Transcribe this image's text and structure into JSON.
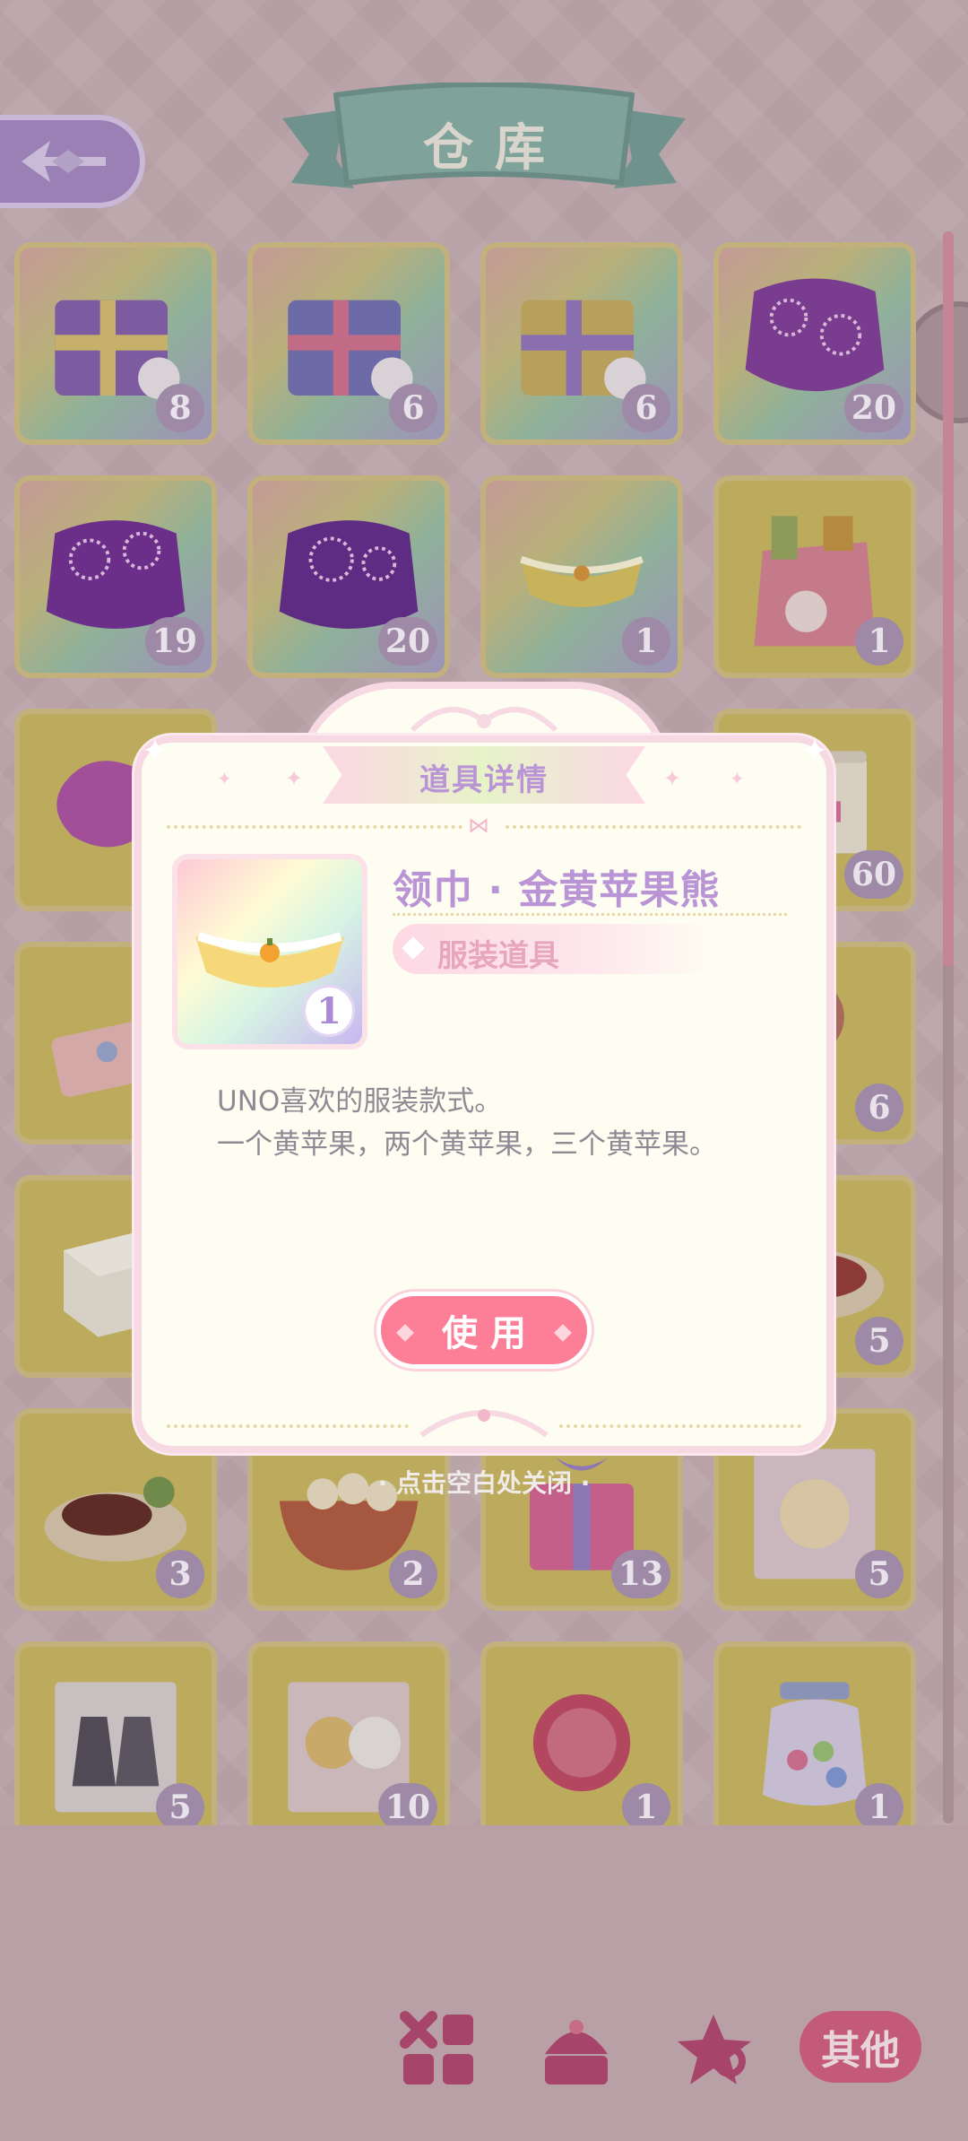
{
  "header": {
    "title": "仓库"
  },
  "grid": {
    "items": [
      {
        "count": "8",
        "name": "gift-box-mask"
      },
      {
        "count": "6",
        "name": "gift-box-ribbon"
      },
      {
        "count": "6",
        "name": "gift-box-feather"
      },
      {
        "count": "20",
        "name": "firework-pink"
      },
      {
        "count": "19",
        "name": "firework-purple"
      },
      {
        "count": "20",
        "name": "firework-purple-2"
      },
      {
        "count": "1",
        "name": "collar-apple-bear"
      },
      {
        "count": "1",
        "name": "grocery-bag"
      },
      {
        "count": "",
        "name": "pink-stone"
      },
      {
        "count": "60",
        "name": "scroll"
      },
      {
        "count": "",
        "name": "ticket"
      },
      {
        "count": "6",
        "name": "paddle"
      },
      {
        "count": "",
        "name": "tofu"
      },
      {
        "count": "5",
        "name": "meat-plate"
      },
      {
        "count": "3",
        "name": "steak-plate"
      },
      {
        "count": "2",
        "name": "dumpling-bowl"
      },
      {
        "count": "13",
        "name": "pink-gift"
      },
      {
        "count": "5",
        "name": "sticker-pack-pink"
      },
      {
        "count": "5",
        "name": "sticker-pack-dress"
      },
      {
        "count": "10",
        "name": "sticker-pack-girls"
      },
      {
        "count": "1",
        "name": "badge-coin"
      },
      {
        "count": "1",
        "name": "candy-jar"
      }
    ]
  },
  "modal": {
    "title": "道具详情",
    "item_name": "领巾 · 金黄苹果熊",
    "category": "服装道具",
    "count": "1",
    "desc_line1": "UNO喜欢的服装款式。",
    "desc_line2": "一个黄苹果，两个黄苹果，三个黄苹果。",
    "use_label": "使用"
  },
  "close_hint": "· 点击空白处关闭 ·",
  "bottom_tabs": {
    "other_label": "其他"
  }
}
